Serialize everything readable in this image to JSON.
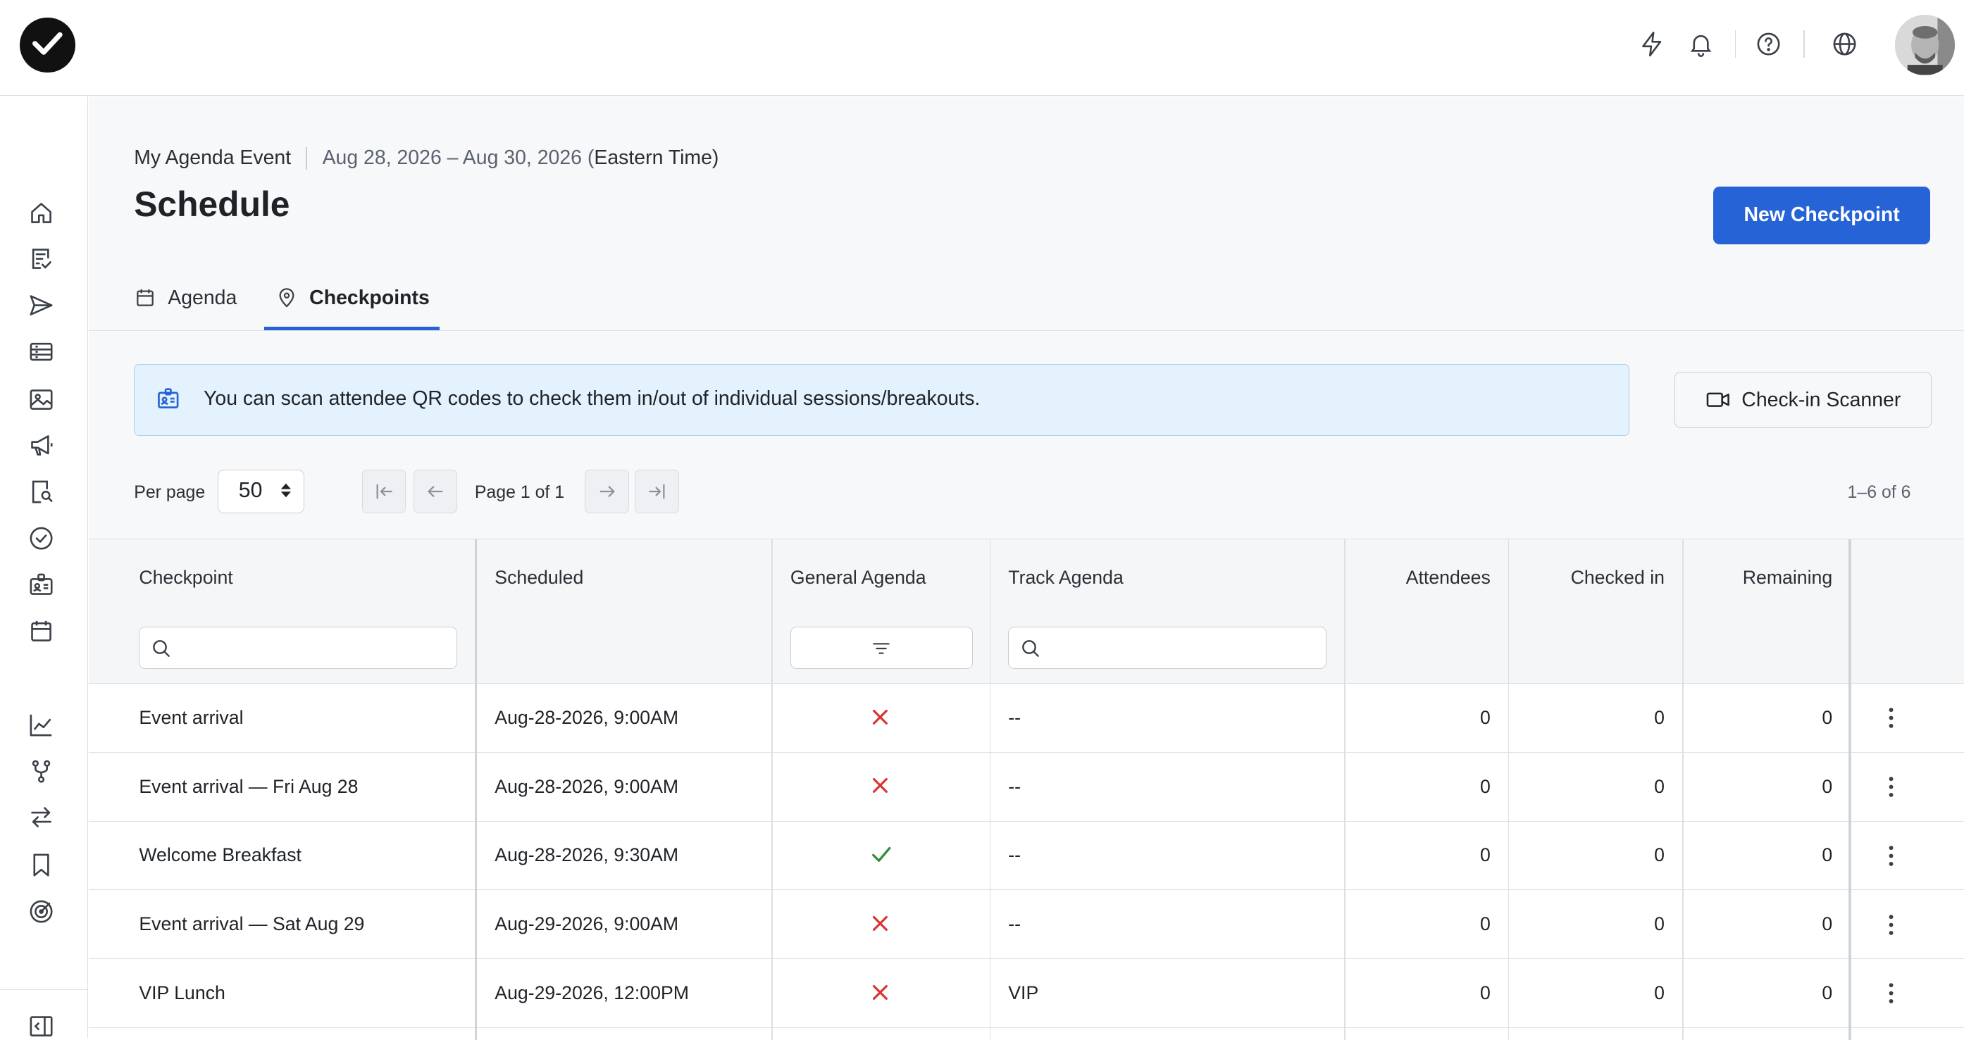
{
  "app": {
    "logo_icon": "checkmark-logo-icon",
    "top_icons": [
      "lightning-icon",
      "bell-icon",
      "help-circle-icon",
      "globe-icon"
    ],
    "sidebar_icons": [
      "home-icon",
      "checklist-icon",
      "send-icon",
      "list-icon",
      "image-icon",
      "megaphone-icon",
      "badge-search-icon",
      "check-circle-icon",
      "id-card-icon",
      "calendar-icon",
      "line-chart-icon",
      "branch-icon",
      "swap-icon",
      "bookmark-icon",
      "target-icon",
      "collapse-sidebar-icon"
    ],
    "accent_color": "#2563d6"
  },
  "header": {
    "event_name": "My Agenda Event",
    "dates": "Aug 28, 2026 – Aug 30, 2026 (",
    "timezone": "Eastern Time",
    "tz_close": ")",
    "title": "Schedule",
    "new_button": "New Checkpoint"
  },
  "tabs": [
    {
      "label": "Agenda",
      "icon": "calendar-icon",
      "active": false
    },
    {
      "label": "Checkpoints",
      "icon": "map-pin-icon",
      "active": true
    }
  ],
  "banner": {
    "text": "You can scan attendee QR codes to check them in/out of individual sessions/breakouts.",
    "icon": "id-badge-icon"
  },
  "scanner_button": "Check-in Scanner",
  "pagination": {
    "per_page_label": "Per page",
    "per_page_value": "50",
    "page_info": "Page 1 of 1",
    "range": "1–6 of 6"
  },
  "table": {
    "columns": [
      "Checkpoint",
      "Scheduled",
      "General Agenda",
      "Track Agenda",
      "Attendees",
      "Checked in",
      "Remaining"
    ],
    "rows": [
      {
        "checkpoint": "Event arrival",
        "scheduled": "Aug-28-2026, 9:00AM",
        "general": "cross",
        "track": "--",
        "attendees": "0",
        "checked_in": "0",
        "remaining": "0"
      },
      {
        "checkpoint": "Event arrival — Fri Aug 28",
        "scheduled": "Aug-28-2026, 9:00AM",
        "general": "cross",
        "track": "--",
        "attendees": "0",
        "checked_in": "0",
        "remaining": "0"
      },
      {
        "checkpoint": "Welcome Breakfast",
        "scheduled": "Aug-28-2026, 9:30AM",
        "general": "check",
        "track": "--",
        "attendees": "0",
        "checked_in": "0",
        "remaining": "0"
      },
      {
        "checkpoint": "Event arrival — Sat Aug 29",
        "scheduled": "Aug-29-2026, 9:00AM",
        "general": "cross",
        "track": "--",
        "attendees": "0",
        "checked_in": "0",
        "remaining": "0"
      },
      {
        "checkpoint": "VIP Lunch",
        "scheduled": "Aug-29-2026, 12:00PM",
        "general": "cross",
        "track": "VIP",
        "attendees": "0",
        "checked_in": "0",
        "remaining": "0"
      }
    ]
  }
}
